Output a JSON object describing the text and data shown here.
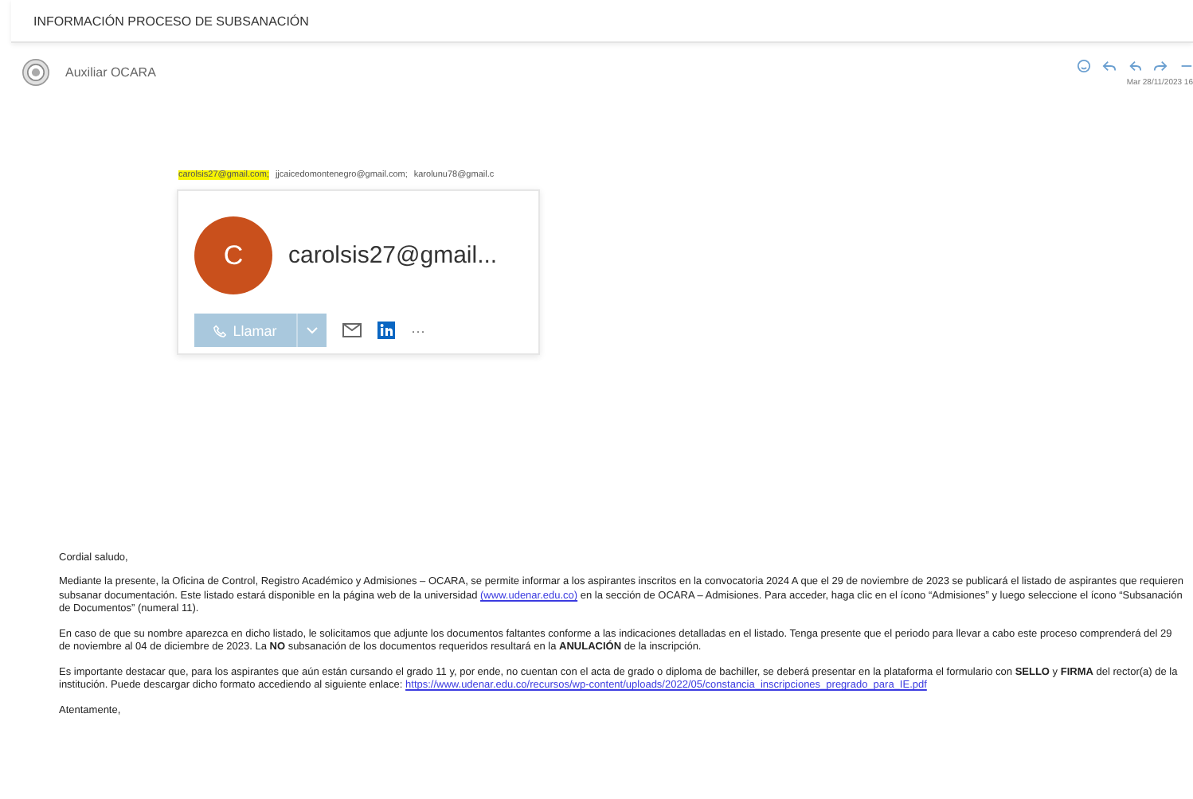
{
  "subject": "INFORMACIÓN PROCESO DE SUBSANACIÓN",
  "sender": {
    "name": "Auxiliar OCARA",
    "date": "Mar 28/11/2023 16"
  },
  "recipients": [
    {
      "address": "carolsis27@gmail.com;",
      "selected": true
    },
    {
      "address": "jjcaicedomontenegro@gmail.com;",
      "selected": false
    },
    {
      "address": "karolunu78@gmail.c",
      "selected": false
    }
  ],
  "contact_card": {
    "initial": "C",
    "name": "carolsis27@gmail...",
    "call_label": "Llamar",
    "more": "···"
  },
  "body": {
    "greeting": "Cordial saludo,",
    "paragraphs": [
      [
        {
          "kind": "text",
          "text": "Mediante la presente, la Oficina de Control, Registro Académico y Admisiones – OCARA, se permite informar a los aspirantes inscritos en la convocatoria 2024 A que el 29 de noviembre de 2023 se publicará el listado de aspirantes que requieren subsanar documentación. Este listado estará disponible en la página web de la universidad "
        },
        {
          "kind": "link",
          "text": "(www.udenar.edu.co)"
        },
        {
          "kind": "text",
          "text": " en la sección de OCARA – Admisiones. Para acceder, haga clic en el ícono “Admisiones” y luego seleccione el ícono “Subsanación de Documentos” (numeral 11)."
        }
      ],
      [
        {
          "kind": "text",
          "text": "En caso de que su nombre aparezca en dicho listado, le solicitamos que adjunte los documentos faltantes conforme a las indicaciones detalladas en el listado. Tenga presente que el periodo para llevar a cabo este proceso comprenderá del 29 de noviembre al 04 de diciembre de 2023. La **NO** subsanación de los documentos requeridos resultará en la **ANULACIÓN** de la inscripción."
        }
      ],
      [
        {
          "kind": "text",
          "text": "Es importante destacar que, para los aspirantes que aún están cursando el grado 11 y, por ende, no cuentan con el acta de grado o diploma de bachiller, se deberá presentar en la plataforma el formulario con **SELLO** y **FIRMA** del rector(a) de la institución. Puede descargar dicho formato accediendo al siguiente enlace: "
        },
        {
          "kind": "link",
          "text": "https://www.udenar.edu.co/recursos/wp-content/uploads/2022/05/constancia_inscripciones_pregrado_para_IE.pdf"
        }
      ]
    ],
    "closing": "Atentamente,"
  }
}
